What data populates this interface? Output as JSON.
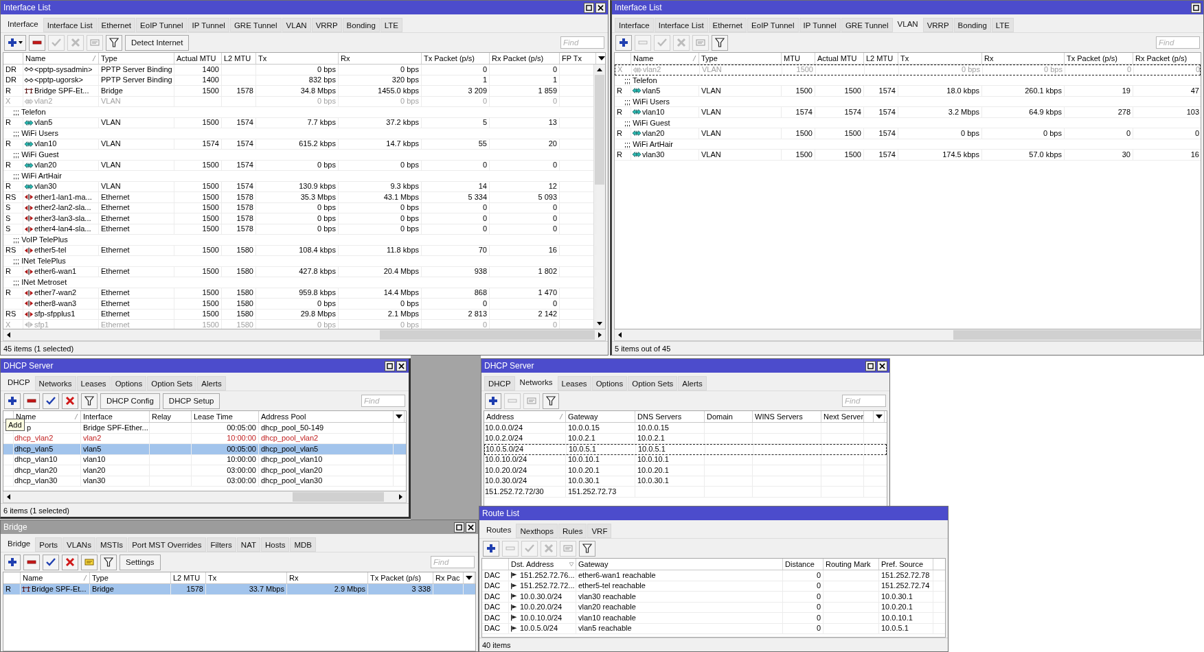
{
  "windows": [
    {
      "title": "Interface List",
      "active": true,
      "tabs": [
        {
          "label": "Interface",
          "selected": true
        },
        {
          "label": "Interface List",
          "selected": false
        },
        {
          "label": "Ethernet",
          "selected": false
        },
        {
          "label": "EoIP Tunnel",
          "selected": false
        },
        {
          "label": "IP Tunnel",
          "selected": false
        },
        {
          "label": "GRE Tunnel",
          "selected": false
        },
        {
          "label": "VLAN",
          "selected": false
        },
        {
          "label": "VRRP",
          "selected": false
        },
        {
          "label": "Bonding",
          "selected": false
        },
        {
          "label": "LTE",
          "selected": false
        }
      ],
      "toolbar": [
        {
          "kind": "add",
          "disabled": false,
          "menu": true
        },
        {
          "kind": "remove",
          "disabled": false
        },
        {
          "kind": "enable",
          "disabled": true
        },
        {
          "kind": "disable",
          "disabled": true
        },
        {
          "kind": "comment",
          "disabled": true
        },
        {
          "kind": "filter",
          "disabled": false
        },
        {
          "kind": "text",
          "label": "Detect Internet",
          "disabled": false
        }
      ],
      "find_placeholder": "Find",
      "table": {
        "columns": [
          {
            "label": "Name"
          },
          {
            "label": "Type"
          },
          {
            "label": "Actual MTU"
          },
          {
            "label": "L2 MTU"
          },
          {
            "label": "Tx"
          },
          {
            "label": "Rx"
          },
          {
            "label": "Tx Packet (p/s)"
          },
          {
            "label": "Rx Packet (p/s)"
          },
          {
            "label": "FP Tx"
          }
        ],
        "rows": [
          {
            "kind": "pptp",
            "flags": "DR",
            "cells": [
              "<pptp-sysadmin>",
              "PPTP Server Binding",
              "1400",
              null,
              "0 bps",
              "0 bps",
              "0",
              "0",
              null
            ],
            "selected": false,
            "disabled": false
          },
          {
            "kind": "pptp",
            "flags": "DR",
            "cells": [
              "<pptp-ugorsk>",
              "PPTP Server Binding",
              "1400",
              null,
              "832 bps",
              "320 bps",
              "1",
              "1",
              null
            ],
            "selected": false,
            "disabled": false
          },
          {
            "kind": "bridge",
            "flags": "R",
            "cells": [
              "Bridge SPF-Et...",
              "Bridge",
              "1500",
              "1578",
              "34.8 Mbps",
              "1455.0 kbps",
              "3 209",
              "1 859",
              null
            ],
            "selected": false,
            "disabled": false
          },
          {
            "kind": "vlan",
            "flags": "X",
            "cells": [
              "vlan2",
              "VLAN",
              null,
              null,
              "0 bps",
              "0 bps",
              "0",
              "0",
              null
            ],
            "selected": false,
            "disabled": true
          },
          {
            "kind": "comment",
            "text": ";;; Telefon"
          },
          {
            "kind": "vlan",
            "flags": "R",
            "cells": [
              "vlan5",
              "VLAN",
              "1500",
              "1574",
              "7.7 kbps",
              "37.2 kbps",
              "5",
              "13",
              null
            ],
            "selected": false,
            "disabled": false
          },
          {
            "kind": "comment",
            "text": ";;; WiFi Users"
          },
          {
            "kind": "vlan",
            "flags": "R",
            "cells": [
              "vlan10",
              "VLAN",
              "1574",
              "1574",
              "615.2 kbps",
              "14.7 kbps",
              "55",
              "20",
              null
            ],
            "selected": false,
            "disabled": false
          },
          {
            "kind": "comment",
            "text": ";;; WiFi Guest"
          },
          {
            "kind": "vlan",
            "flags": "R",
            "cells": [
              "vlan20",
              "VLAN",
              "1500",
              "1574",
              "0 bps",
              "0 bps",
              "0",
              "0",
              null
            ],
            "selected": false,
            "disabled": false
          },
          {
            "kind": "comment",
            "text": ";;; WiFi ArtHair"
          },
          {
            "kind": "vlan",
            "flags": "R",
            "cells": [
              "vlan30",
              "VLAN",
              "1500",
              "1574",
              "130.9 kbps",
              "9.3 kbps",
              "14",
              "12",
              null
            ],
            "selected": false,
            "disabled": false
          },
          {
            "kind": "ether",
            "flags": "RS",
            "cells": [
              "ether1-lan1-ma...",
              "Ethernet",
              "1500",
              "1578",
              "35.3 Mbps",
              "43.1 Mbps",
              "5 334",
              "5 093",
              null
            ],
            "selected": false,
            "disabled": false
          },
          {
            "kind": "ether",
            "flags": "S",
            "cells": [
              "ether2-lan2-sla...",
              "Ethernet",
              "1500",
              "1578",
              "0 bps",
              "0 bps",
              "0",
              "0",
              null
            ],
            "selected": false,
            "disabled": false
          },
          {
            "kind": "ether",
            "flags": "S",
            "cells": [
              "ether3-lan3-sla...",
              "Ethernet",
              "1500",
              "1578",
              "0 bps",
              "0 bps",
              "0",
              "0",
              null
            ],
            "selected": false,
            "disabled": false
          },
          {
            "kind": "ether",
            "flags": "S",
            "cells": [
              "ether4-lan4-sla...",
              "Ethernet",
              "1500",
              "1578",
              "0 bps",
              "0 bps",
              "0",
              "0",
              null
            ],
            "selected": false,
            "disabled": false
          },
          {
            "kind": "comment",
            "text": ";;; VoIP TelePlus"
          },
          {
            "kind": "ether",
            "flags": "RS",
            "cells": [
              "ether5-tel",
              "Ethernet",
              "1500",
              "1580",
              "108.4 kbps",
              "11.8 kbps",
              "70",
              "16",
              null
            ],
            "selected": false,
            "disabled": false
          },
          {
            "kind": "comment",
            "text": ";;; INet TelePlus"
          },
          {
            "kind": "ether",
            "flags": "R",
            "cells": [
              "ether6-wan1",
              "Ethernet",
              "1500",
              "1580",
              "427.8 kbps",
              "20.4 Mbps",
              "938",
              "1 802",
              null
            ],
            "selected": false,
            "disabled": false
          },
          {
            "kind": "comment",
            "text": ";;; INet Metroset"
          },
          {
            "kind": "ether",
            "flags": "R",
            "cells": [
              "ether7-wan2",
              "Ethernet",
              "1500",
              "1580",
              "959.8 kbps",
              "14.4 Mbps",
              "868",
              "1 470",
              null
            ],
            "selected": false,
            "disabled": false
          },
          {
            "kind": "ether",
            "flags": null,
            "cells": [
              "ether8-wan3",
              "Ethernet",
              "1500",
              "1580",
              "0 bps",
              "0 bps",
              "0",
              "0",
              null
            ],
            "selected": false,
            "disabled": false
          },
          {
            "kind": "ether",
            "flags": "RS",
            "cells": [
              "sfp-sfpplus1",
              "Ethernet",
              "1500",
              "1580",
              "29.8 Mbps",
              "2.1 Mbps",
              "2 813",
              "2 142",
              null
            ],
            "selected": false,
            "disabled": false
          },
          {
            "kind": "ether",
            "flags": "X",
            "cells": [
              "sfp1",
              "Ethernet",
              "1500",
              "1580",
              "0 bps",
              "0 bps",
              "0",
              "0",
              null
            ],
            "selected": false,
            "disabled": true
          }
        ]
      },
      "status": "45 items (1 selected)"
    },
    {
      "title": "Interface List",
      "active": true,
      "tabs": [
        {
          "label": "Interface",
          "selected": false
        },
        {
          "label": "Interface List",
          "selected": false
        },
        {
          "label": "Ethernet",
          "selected": false
        },
        {
          "label": "EoIP Tunnel",
          "selected": false
        },
        {
          "label": "IP Tunnel",
          "selected": false
        },
        {
          "label": "GRE Tunnel",
          "selected": false
        },
        {
          "label": "VLAN",
          "selected": true
        },
        {
          "label": "VRRP",
          "selected": false
        },
        {
          "label": "Bonding",
          "selected": false
        },
        {
          "label": "LTE",
          "selected": false
        }
      ],
      "toolbar": [
        {
          "kind": "add",
          "disabled": false,
          "menu": false
        },
        {
          "kind": "remove",
          "disabled": true
        },
        {
          "kind": "enable",
          "disabled": true
        },
        {
          "kind": "disable",
          "disabled": true
        },
        {
          "kind": "comment",
          "disabled": true
        },
        {
          "kind": "filter",
          "disabled": false
        }
      ],
      "find_placeholder": "Find",
      "table": {
        "columns": [
          {
            "label": "Name"
          },
          {
            "label": "Type"
          },
          {
            "label": "MTU"
          },
          {
            "label": "Actual MTU"
          },
          {
            "label": "L2 MTU"
          },
          {
            "label": "Tx"
          },
          {
            "label": "Rx"
          },
          {
            "label": "Tx Packet (p/s)"
          },
          {
            "label": "Rx Packet (p/s)"
          }
        ],
        "rows": [
          {
            "kind": "vlan",
            "flags": "X",
            "cells": [
              "vlan2",
              "VLAN",
              "1500",
              null,
              null,
              "0 bps",
              "0 bps",
              "0",
              "0"
            ],
            "selected": false,
            "disabled": true,
            "focused": true
          },
          {
            "kind": "comment",
            "text": ";;; Telefon"
          },
          {
            "kind": "vlan",
            "flags": "R",
            "cells": [
              "vlan5",
              "VLAN",
              "1500",
              "1500",
              "1574",
              "18.0 kbps",
              "260.1 kbps",
              "19",
              "47"
            ],
            "selected": false,
            "disabled": false,
            "focused": false
          },
          {
            "kind": "comment",
            "text": ";;; WiFi Users"
          },
          {
            "kind": "vlan",
            "flags": "R",
            "cells": [
              "vlan10",
              "VLAN",
              "1574",
              "1574",
              "1574",
              "3.2 Mbps",
              "64.9 kbps",
              "278",
              "103"
            ],
            "selected": false,
            "disabled": false,
            "focused": false
          },
          {
            "kind": "comment",
            "text": ";;; WiFi Guest"
          },
          {
            "kind": "vlan",
            "flags": "R",
            "cells": [
              "vlan20",
              "VLAN",
              "1500",
              "1500",
              "1574",
              "0 bps",
              "0 bps",
              "0",
              "0"
            ],
            "selected": false,
            "disabled": false,
            "focused": false
          },
          {
            "kind": "comment",
            "text": ";;; WiFi ArtHair"
          },
          {
            "kind": "vlan",
            "flags": "R",
            "cells": [
              "vlan30",
              "VLAN",
              "1500",
              "1500",
              "1574",
              "174.5 kbps",
              "57.0 kbps",
              "30",
              "16"
            ],
            "selected": false,
            "disabled": false,
            "focused": false
          }
        ]
      },
      "status": "5 items out of 45"
    },
    {
      "title": "DHCP Server",
      "active": true,
      "tabs": [
        {
          "label": "DHCP",
          "selected": true
        },
        {
          "label": "Networks",
          "selected": false
        },
        {
          "label": "Leases",
          "selected": false
        },
        {
          "label": "Options",
          "selected": false
        },
        {
          "label": "Option Sets",
          "selected": false
        },
        {
          "label": "Alerts",
          "selected": false
        }
      ],
      "toolbar": [
        {
          "kind": "add",
          "disabled": false,
          "menu": false
        },
        {
          "kind": "remove",
          "disabled": false
        },
        {
          "kind": "enable",
          "disabled": false
        },
        {
          "kind": "disable",
          "disabled": false
        },
        {
          "kind": "filter",
          "disabled": false
        },
        {
          "kind": "text",
          "label": "DHCP Config",
          "disabled": false
        },
        {
          "kind": "text",
          "label": "DHCP Setup",
          "disabled": false
        }
      ],
      "find_placeholder": "Find",
      "table": {
        "columns": [
          {
            "label": "Name"
          },
          {
            "label": "Interface"
          },
          {
            "label": "Relay"
          },
          {
            "label": "Lease Time"
          },
          {
            "label": "Address Pool"
          }
        ],
        "rows": [
          {
            "kind": "plain",
            "tooltip": "Add",
            "cells": [
              "p",
              "Bridge SPF-Ether...",
              null,
              "00:05:00",
              "dhcp_pool_50-149"
            ],
            "selected": false,
            "invalid": false
          },
          {
            "kind": "plain",
            "cells": [
              "dhcp_vlan2",
              "vlan2",
              null,
              "10:00:00",
              "dhcp_pool_vlan2"
            ],
            "selected": false,
            "invalid": true
          },
          {
            "kind": "plain",
            "cells": [
              "dhcp_vlan5",
              "vlan5",
              null,
              "00:05:00",
              "dhcp_pool_vlan5"
            ],
            "selected": true,
            "invalid": false
          },
          {
            "kind": "plain",
            "cells": [
              "dhcp_vlan10",
              "vlan10",
              null,
              "10:00:00",
              "dhcp_pool_vlan10"
            ],
            "selected": false,
            "invalid": false
          },
          {
            "kind": "plain",
            "cells": [
              "dhcp_vlan20",
              "vlan20",
              null,
              "03:00:00",
              "dhcp_pool_vlan20"
            ],
            "selected": false,
            "invalid": false
          },
          {
            "kind": "plain",
            "cells": [
              "dhcp_vlan30",
              "vlan30",
              null,
              "03:00:00",
              "dhcp_pool_vlan30"
            ],
            "selected": false,
            "invalid": false
          }
        ]
      },
      "status": "6 items (1 selected)"
    },
    {
      "title": "DHCP Server",
      "active": true,
      "tabs": [
        {
          "label": "DHCP",
          "selected": false
        },
        {
          "label": "Networks",
          "selected": true
        },
        {
          "label": "Leases",
          "selected": false
        },
        {
          "label": "Options",
          "selected": false
        },
        {
          "label": "Option Sets",
          "selected": false
        },
        {
          "label": "Alerts",
          "selected": false
        }
      ],
      "toolbar": [
        {
          "kind": "add",
          "disabled": false,
          "menu": false
        },
        {
          "kind": "remove",
          "disabled": true
        },
        {
          "kind": "comment",
          "disabled": true
        },
        {
          "kind": "filter",
          "disabled": false
        }
      ],
      "find_placeholder": "Find",
      "table": {
        "columns": [
          {
            "label": "Address"
          },
          {
            "label": "Gateway"
          },
          {
            "label": "DNS Servers"
          },
          {
            "label": "Domain"
          },
          {
            "label": "WINS Servers"
          },
          {
            "label": "Next Server"
          }
        ],
        "rows": [
          {
            "kind": "plain",
            "cells": [
              "10.0.0.0/24",
              "10.0.0.15",
              "10.0.0.15",
              null,
              null,
              null
            ],
            "focused": false
          },
          {
            "kind": "plain",
            "cells": [
              "10.0.2.0/24",
              "10.0.2.1",
              "10.0.2.1",
              null,
              null,
              null
            ],
            "focused": false
          },
          {
            "kind": "plain",
            "cells": [
              "10.0.5.0/24",
              "10.0.5.1",
              "10.0.5.1",
              null,
              null,
              null
            ],
            "focused": true
          },
          {
            "kind": "plain",
            "cells": [
              "10.0.10.0/24",
              "10.0.10.1",
              "10.0.10.1",
              null,
              null,
              null
            ],
            "focused": false
          },
          {
            "kind": "plain",
            "cells": [
              "10.0.20.0/24",
              "10.0.20.1",
              "10.0.20.1",
              null,
              null,
              null
            ],
            "focused": false
          },
          {
            "kind": "plain",
            "cells": [
              "10.0.30.0/24",
              "10.0.30.1",
              "10.0.30.1",
              null,
              null,
              null
            ],
            "focused": false
          },
          {
            "kind": "plain",
            "cells": [
              "151.252.72.72/30",
              "151.252.72.73",
              null,
              null,
              null,
              null
            ],
            "focused": false
          }
        ]
      }
    },
    {
      "title": "Route List",
      "active": true,
      "tabs": [
        {
          "label": "Routes",
          "selected": true
        },
        {
          "label": "Nexthops",
          "selected": false
        },
        {
          "label": "Rules",
          "selected": false
        },
        {
          "label": "VRF",
          "selected": false
        }
      ],
      "toolbar": [
        {
          "kind": "add",
          "disabled": false,
          "menu": false
        },
        {
          "kind": "remove",
          "disabled": true
        },
        {
          "kind": "enable",
          "disabled": true
        },
        {
          "kind": "disable",
          "disabled": true
        },
        {
          "kind": "comment",
          "disabled": true
        },
        {
          "kind": "filter",
          "disabled": false
        }
      ],
      "table": {
        "columns": [
          {
            "label": "Dst. Address"
          },
          {
            "label": "Gateway"
          },
          {
            "label": "Distance"
          },
          {
            "label": "Routing Mark"
          },
          {
            "label": "Pref. Source"
          }
        ],
        "rows": [
          {
            "kind": "route",
            "flags": "DAC",
            "cells": [
              "151.252.72.76...",
              "ether6-wan1 reachable",
              "0",
              null,
              "151.252.72.78"
            ]
          },
          {
            "kind": "route",
            "flags": "DAC",
            "cells": [
              "151.252.72.72...",
              "ether5-tel reachable",
              "0",
              null,
              "151.252.72.74"
            ]
          },
          {
            "kind": "route",
            "flags": "DAC",
            "cells": [
              "10.0.30.0/24",
              "vlan30 reachable",
              "0",
              null,
              "10.0.30.1"
            ]
          },
          {
            "kind": "route",
            "flags": "DAC",
            "cells": [
              "10.0.20.0/24",
              "vlan20 reachable",
              "0",
              null,
              "10.0.20.1"
            ]
          },
          {
            "kind": "route",
            "flags": "DAC",
            "cells": [
              "10.0.10.0/24",
              "vlan10 reachable",
              "0",
              null,
              "10.0.10.1"
            ]
          },
          {
            "kind": "route",
            "flags": "DAC",
            "cells": [
              "10.0.5.0/24",
              "vlan5 reachable",
              "0",
              null,
              "10.0.5.1"
            ]
          }
        ]
      },
      "status": "40 items"
    },
    {
      "title": "Bridge",
      "active": false,
      "tabs": [
        {
          "label": "Bridge",
          "selected": true
        },
        {
          "label": "Ports",
          "selected": false
        },
        {
          "label": "VLANs",
          "selected": false
        },
        {
          "label": "MSTIs",
          "selected": false
        },
        {
          "label": "Port MST Overrides",
          "selected": false
        },
        {
          "label": "Filters",
          "selected": false
        },
        {
          "label": "NAT",
          "selected": false
        },
        {
          "label": "Hosts",
          "selected": false
        },
        {
          "label": "MDB",
          "selected": false
        }
      ],
      "toolbar": [
        {
          "kind": "add",
          "disabled": false,
          "menu": false
        },
        {
          "kind": "remove",
          "disabled": false
        },
        {
          "kind": "enable",
          "disabled": false
        },
        {
          "kind": "disable",
          "disabled": false
        },
        {
          "kind": "comment",
          "disabled": false
        },
        {
          "kind": "filter",
          "disabled": false
        },
        {
          "kind": "text",
          "label": "Settings",
          "disabled": false
        }
      ],
      "find_placeholder": "Find",
      "table": {
        "columns": [
          {
            "label": "Name"
          },
          {
            "label": "Type"
          },
          {
            "label": "L2 MTU"
          },
          {
            "label": "Tx"
          },
          {
            "label": "Rx"
          },
          {
            "label": "Tx Packet (p/s)"
          },
          {
            "label": "Rx Pac"
          }
        ],
        "rows": [
          {
            "kind": "bridge",
            "flags": "R",
            "cells": [
              "Bridge SPF-Et...",
              "Bridge",
              "1578",
              "33.7 Mbps",
              "2.9 Mbps",
              "3 338",
              null
            ],
            "selected": true
          }
        ]
      }
    }
  ]
}
